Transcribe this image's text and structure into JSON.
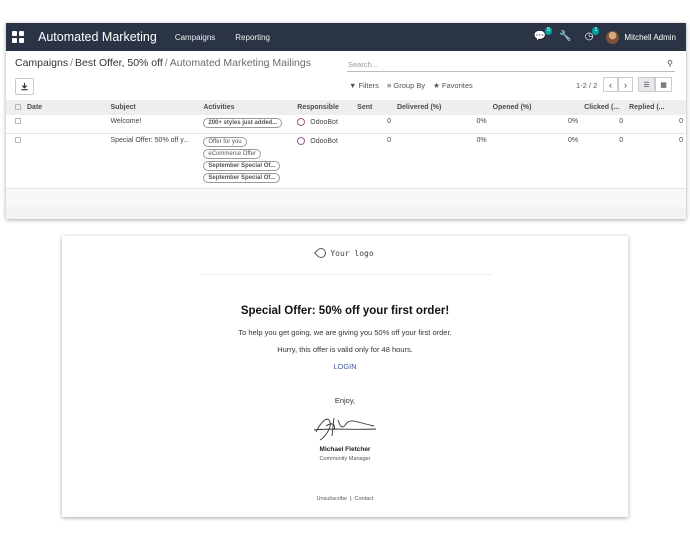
{
  "navbar": {
    "app_name": "Automated Marketing",
    "menu": [
      "Campaigns",
      "Reporting"
    ],
    "chat_badge": "5",
    "activity_badge": "1",
    "user_name": "Mitchell Admin"
  },
  "breadcrumb": {
    "items": [
      "Campaigns",
      "Best Offer, 50% off"
    ],
    "current": "Automated Marketing Mailings"
  },
  "search": {
    "placeholder": "Search..."
  },
  "filters": {
    "filters_label": "Filters",
    "groupby_label": "Group By",
    "favorites_label": "Favorites"
  },
  "pager": {
    "value": "1-2 / 2"
  },
  "table": {
    "columns": [
      "Date",
      "Subject",
      "Activities",
      "Responsible",
      "Sent",
      "Delivered (%)",
      "Opened (%)",
      "Clicked (...",
      "Replied (..."
    ],
    "rows": [
      {
        "date": "",
        "subject": "Welcome!",
        "activities": [
          "200+ styles just added..."
        ],
        "responsible": "OdooBot",
        "sent": "0",
        "delivered": "0%",
        "opened": "0%",
        "clicked": "0",
        "replied": "0"
      },
      {
        "date": "",
        "subject": "Special Offer: 50% off y...",
        "activities": [
          "Offer for you",
          "eCommerce Offer",
          "September Special Of...",
          "September Special Of..."
        ],
        "responsible": "OdooBot",
        "sent": "0",
        "delivered": "0%",
        "opened": "0%",
        "clicked": "0",
        "replied": "0"
      }
    ]
  },
  "email": {
    "logo_text": "Your logo",
    "title": "Special Offer: 50% off your first order!",
    "line1": "To help you get going, we are giving you 50% off your first order.",
    "line2": "Hurry, this offer is valid only for 48 hours.",
    "login": "LOGIN",
    "enjoy": "Enjoy,",
    "signer_name": "Michael Fletcher",
    "signer_role": "Community Manager",
    "unsubscribe": "Unsubscribe",
    "contact": "Contact"
  },
  "colors": {
    "navbar": "#2b3444",
    "link": "#3d57a5",
    "badge": "#00a09d"
  }
}
